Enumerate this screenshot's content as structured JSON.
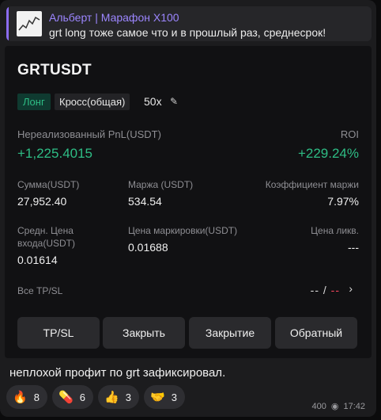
{
  "reply": {
    "author": "Альберт | Марафон X100",
    "text": "grt long тоже самое что и в прошлый раз, среднесрок!"
  },
  "position": {
    "symbol": "GRTUSDT",
    "side": "Лонг",
    "margin_mode": "Кросс(общая)",
    "leverage": "50x",
    "pnl_label": "Нереализованный PnL(USDT)",
    "pnl_value": "+1,225.4015",
    "roi_label": "ROI",
    "roi_value": "+229.24%",
    "size_label": "Сумма(USDT)",
    "size_value": "27,952.40",
    "margin_label": "Маржа (USDT)",
    "margin_value": "534.54",
    "ratio_label": "Коэффициент маржи",
    "ratio_value": "7.97%",
    "entry_label_1": "Средн.  Цена",
    "entry_label_2": "входа(USDT)",
    "entry_value": "0.01614",
    "mark_label": "Цена маркировки(USDT)",
    "mark_value": "0.01688",
    "liq_label": "Цена ликв.",
    "liq_value": "---",
    "tpsl_label": "Все TP/SL",
    "tpsl_value_a": "--",
    "tpsl_sep": "/",
    "tpsl_value_b": "--"
  },
  "buttons": {
    "tpsl": "TP/SL",
    "close": "Закрыть",
    "closing": "Закрытие",
    "reverse": "Обратный"
  },
  "message": {
    "text": "неплохой профит по grt зафиксировал.",
    "views": "400",
    "time": "17:42"
  },
  "reactions": [
    {
      "emoji": "🔥",
      "count": "8"
    },
    {
      "emoji": "💊",
      "count": "6"
    },
    {
      "emoji": "👍",
      "count": "3"
    },
    {
      "emoji": "🤝",
      "count": "3"
    }
  ],
  "colors": {
    "accent": "#9c86ff",
    "profit": "#2ebd85",
    "loss": "#f6465d"
  }
}
